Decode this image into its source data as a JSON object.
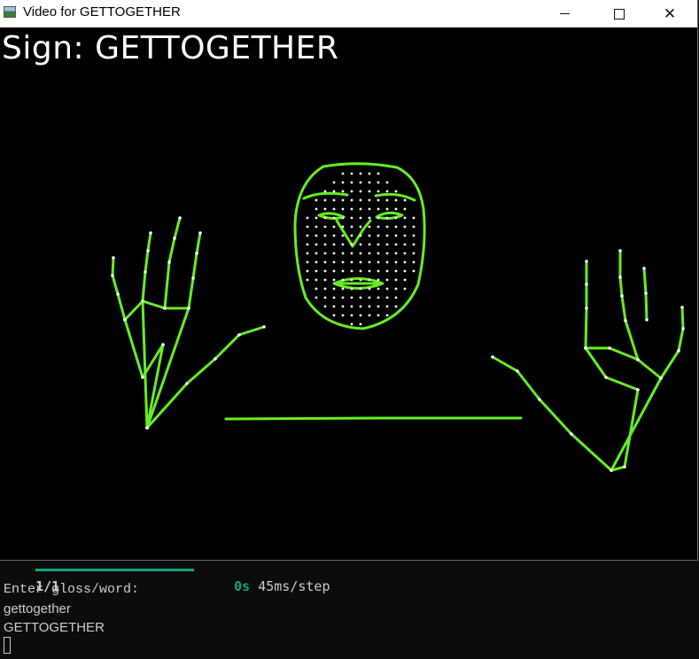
{
  "window": {
    "title": "Video for GETTOGETHER",
    "controls": [
      "minimize",
      "maximize",
      "close"
    ],
    "close_glyph": "✕"
  },
  "canvas": {
    "sign_text": "Sign: GETTOGETHER",
    "skeleton_color": "#66ee22",
    "landmark_color": "#ffffff"
  },
  "terminal": {
    "progress_count": "1/1",
    "progress_fraction": 1.0,
    "elapsed": "0s",
    "rate": "45ms/step",
    "prompt": "Enter gloss/word:",
    "input": "gettogether",
    "output": "GETTOGETHER",
    "accent_color": "#16a085"
  }
}
